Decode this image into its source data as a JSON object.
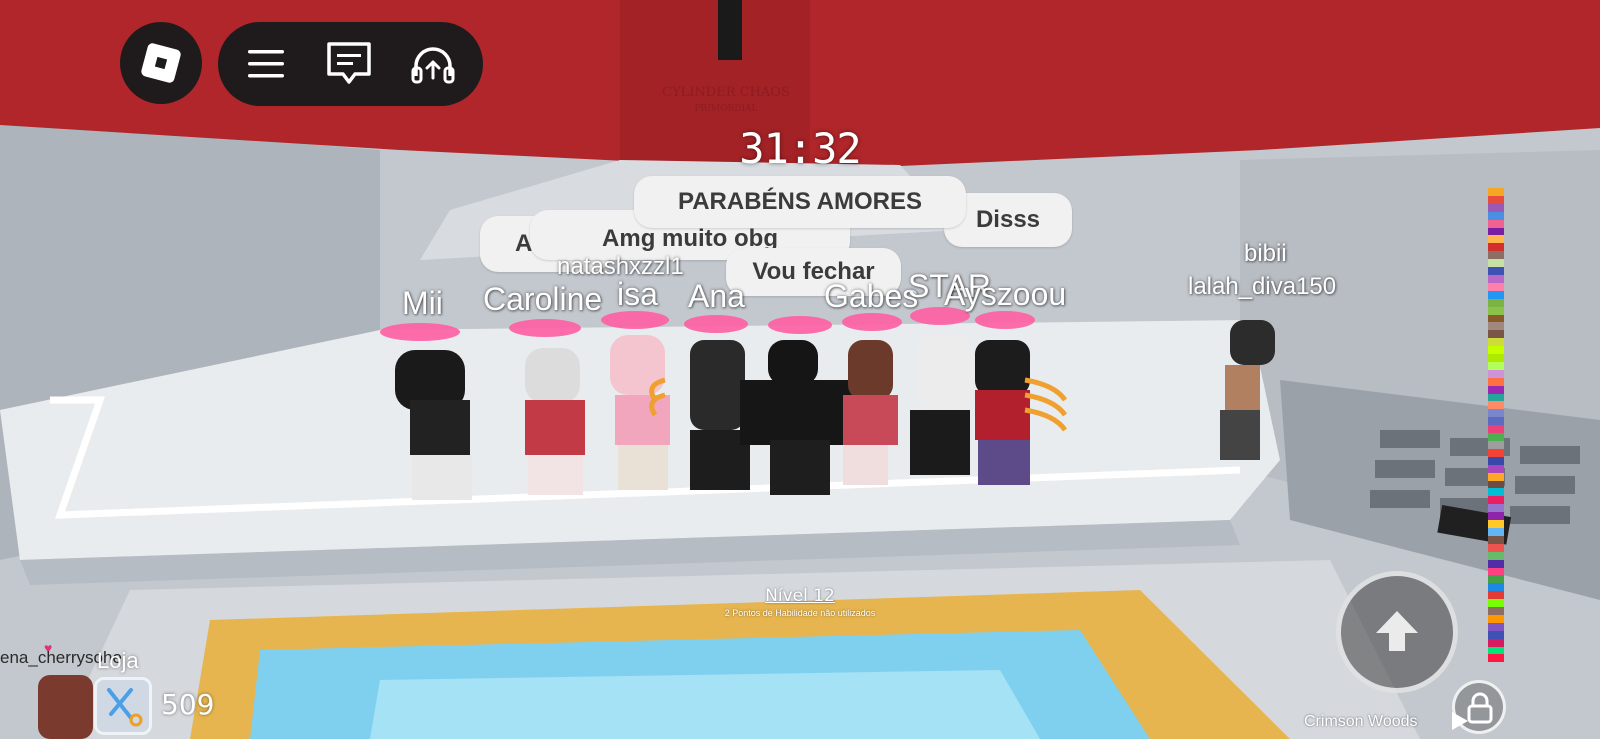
{
  "timer": "31:32",
  "chat_bubbles": [
    {
      "id": "parabens",
      "text": "PARABÉNS AMORES"
    },
    {
      "id": "disss",
      "text": "Disss"
    },
    {
      "id": "amei",
      "text": "AMEI"
    },
    {
      "id": "amg",
      "text": "Amg muito obg"
    },
    {
      "id": "vou",
      "text": "Vou fechar"
    }
  ],
  "players": [
    {
      "name": "Mii"
    },
    {
      "name": "Caroline"
    },
    {
      "name": "isa"
    },
    {
      "name": "Ana"
    },
    {
      "name": "Gabes"
    },
    {
      "name": "STAR"
    },
    {
      "name": "Ayszoou"
    },
    {
      "name": "natashxzzl1"
    },
    {
      "name": "bibii"
    },
    {
      "name": "lalah_diva150"
    }
  ],
  "sign_text": {
    "line1": "CYLINDER CHAOS",
    "line2": "PRIMORDIAL"
  },
  "level": {
    "label": "Nível 12",
    "sub": "2 Pontos de Habilidade não utilizados"
  },
  "bottom_left": {
    "player_name": "ena_cherrysohe",
    "shop_label": "Loja",
    "coins": "509"
  },
  "location": "Crimson Woods",
  "colors": {
    "red_wall": "#b0262a",
    "chat_bubble": "#f1f1f1",
    "top_bar": "#1f1b1c",
    "pool": "#7fd0ee",
    "walkway": "#e6b54f",
    "halo": "#ff5fa3"
  },
  "icons": [
    "roblox-logo-icon",
    "hamburger-menu-icon",
    "chat-icon",
    "headset-icon",
    "jump-arrow-icon",
    "lock-icon",
    "shop-icon",
    "play-icon",
    "heart-icon"
  ],
  "color_strip": [
    "#f5a623",
    "#e74c3c",
    "#9b59b6",
    "#4a90e2",
    "#f06292",
    "#7b1fa2",
    "#ffb74d",
    "#d32f2f",
    "#8d6e63",
    "#c5e1a5",
    "#3f51b5",
    "#ba68c8",
    "#ff80ab",
    "#2196f3",
    "#7cb342",
    "#8bc34a",
    "#8b5a2b",
    "#a1887f",
    "#795548",
    "#cddc39",
    "#c6ff00",
    "#aeea00",
    "#b2ff59",
    "#ce93d8",
    "#ff7043",
    "#9c27b0",
    "#26a69a",
    "#ff8a65",
    "#7986cb",
    "#5c6bc0",
    "#ec407a",
    "#4caf50",
    "#9e9e9e",
    "#f44336",
    "#3949ab",
    "#ab47bc",
    "#ffa726",
    "#6d4c41",
    "#00bcd4",
    "#e91e63",
    "#9575cd",
    "#8e24aa",
    "#ffca28",
    "#64b5f6",
    "#795548",
    "#ef5350",
    "#66bb6a",
    "#512da8",
    "#ff4081",
    "#43a047",
    "#1e88e5",
    "#e53935",
    "#76ff03",
    "#8d6e63",
    "#ff9800",
    "#7e57c2",
    "#3f51b5",
    "#d81b60",
    "#00e676",
    "#ff1744"
  ]
}
